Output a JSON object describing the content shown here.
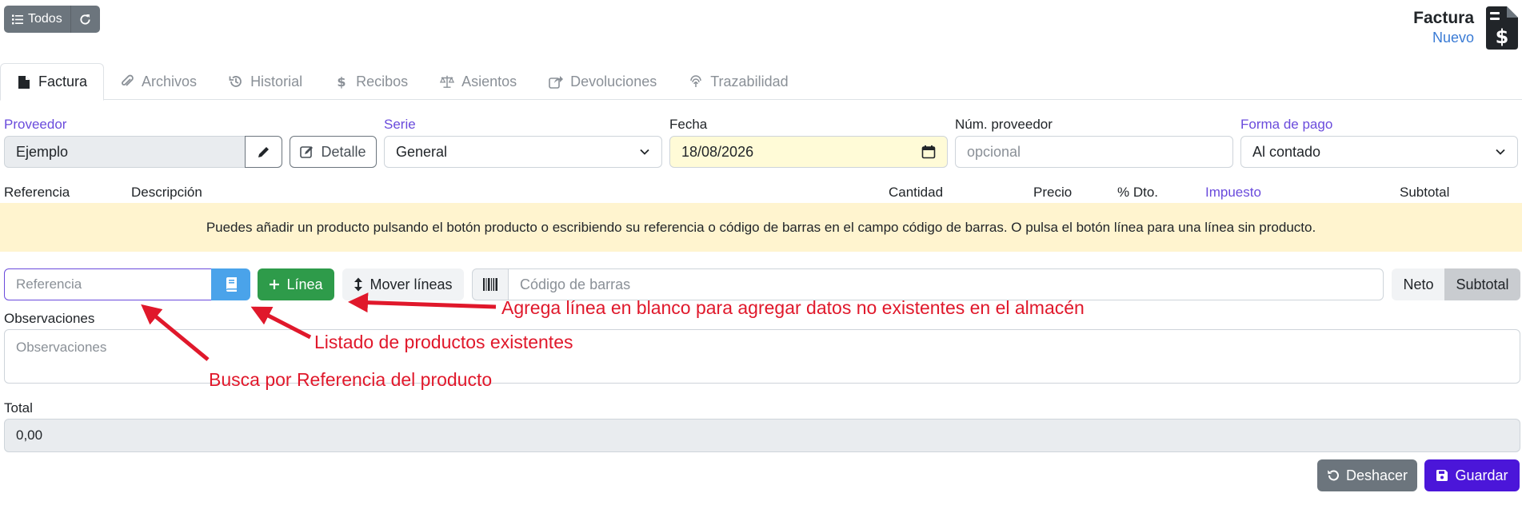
{
  "toolbar": {
    "todos_label": "Todos"
  },
  "document": {
    "title": "Factura",
    "status": "Nuevo"
  },
  "tabs": [
    {
      "label": "Factura",
      "icon": "file-icon"
    },
    {
      "label": "Archivos",
      "icon": "paperclip-icon"
    },
    {
      "label": "Historial",
      "icon": "history-icon"
    },
    {
      "label": "Recibos",
      "icon": "dollar-icon"
    },
    {
      "label": "Asientos",
      "icon": "balance-scale-icon"
    },
    {
      "label": "Devoluciones",
      "icon": "share-icon"
    },
    {
      "label": "Trazabilidad",
      "icon": "fingerprint-icon"
    }
  ],
  "form": {
    "proveedor_label": "Proveedor",
    "proveedor_value": "Ejemplo",
    "detalle_label": "Detalle",
    "serie_label": "Serie",
    "serie_value": "General",
    "fecha_label": "Fecha",
    "fecha_value": "18/08/2026",
    "num_proveedor_label": "Núm. proveedor",
    "num_proveedor_placeholder": "opcional",
    "forma_pago_label": "Forma de pago",
    "forma_pago_value": "Al contado"
  },
  "lines_header": {
    "referencia": "Referencia",
    "descripcion": "Descripción",
    "cantidad": "Cantidad",
    "precio": "Precio",
    "dto": "% Dto.",
    "impuesto": "Impuesto",
    "subtotal": "Subtotal"
  },
  "alert": "Puedes añadir un producto pulsando el botón producto o escribiendo su referencia o código de barras en el campo código de barras. O pulsa el botón línea para una línea sin producto.",
  "line_tools": {
    "referencia_placeholder": "Referencia",
    "linea_label": "Línea",
    "mover_label": "Mover líneas",
    "barcode_placeholder": "Código de barras",
    "neto_label": "Neto",
    "subtotal_label": "Subtotal"
  },
  "observaciones": {
    "label": "Observaciones",
    "placeholder": "Observaciones"
  },
  "total": {
    "label": "Total",
    "value": "0,00"
  },
  "actions": {
    "deshacer": "Deshacer",
    "guardar": "Guardar"
  },
  "annotations": {
    "agrega": "Agrega línea en blanco para agregar datos no existentes en el almacén",
    "listado": "Listado de productos existentes",
    "busca": "Busca por Referencia del producto"
  },
  "colors": {
    "accent": "#6a4bdc",
    "annotation": "#e0182b",
    "success": "#2e9b4a",
    "info": "#4aa3ea",
    "primary": "#4b16d9"
  }
}
